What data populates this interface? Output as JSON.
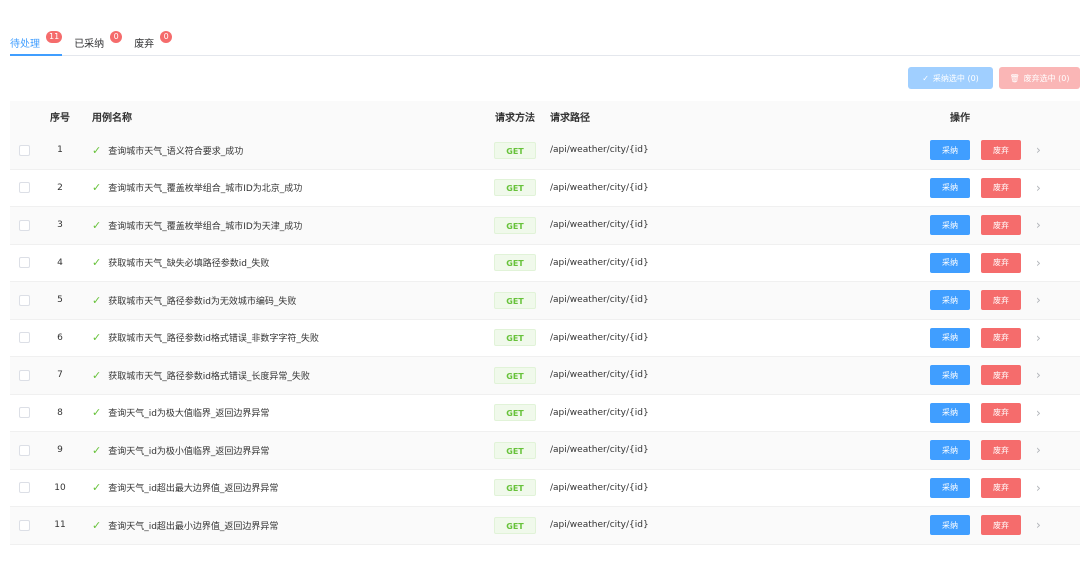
{
  "tabs": [
    {
      "label": "待处理",
      "count": "11"
    },
    {
      "label": "已采纳",
      "count": "0"
    },
    {
      "label": "废弃",
      "count": "0"
    }
  ],
  "toolbar": {
    "accept_selected": "采纳选中 (0)",
    "discard_selected": "废弃选中 (0)"
  },
  "table": {
    "headers": {
      "no": "序号",
      "name": "用例名称",
      "method": "请求方法",
      "path": "请求路径",
      "ops": "操作"
    },
    "rows": [
      {
        "no": "1",
        "name": "查询城市天气_语义符合要求_成功",
        "method": "GET",
        "path": "/api/weather/city/{id}"
      },
      {
        "no": "2",
        "name": "查询城市天气_覆盖枚举组合_城市ID为北京_成功",
        "method": "GET",
        "path": "/api/weather/city/{id}"
      },
      {
        "no": "3",
        "name": "查询城市天气_覆盖枚举组合_城市ID为天津_成功",
        "method": "GET",
        "path": "/api/weather/city/{id}"
      },
      {
        "no": "4",
        "name": "获取城市天气_缺失必填路径参数id_失败",
        "method": "GET",
        "path": "/api/weather/city/{id}"
      },
      {
        "no": "5",
        "name": "获取城市天气_路径参数id为无效城市编码_失败",
        "method": "GET",
        "path": "/api/weather/city/{id}"
      },
      {
        "no": "6",
        "name": "获取城市天气_路径参数id格式错误_非数字字符_失败",
        "method": "GET",
        "path": "/api/weather/city/{id}"
      },
      {
        "no": "7",
        "name": "获取城市天气_路径参数id格式错误_长度异常_失败",
        "method": "GET",
        "path": "/api/weather/city/{id}"
      },
      {
        "no": "8",
        "name": "查询天气_id为极大值临界_返回边界异常",
        "method": "GET",
        "path": "/api/weather/city/{id}"
      },
      {
        "no": "9",
        "name": "查询天气_id为极小值临界_返回边界异常",
        "method": "GET",
        "path": "/api/weather/city/{id}"
      },
      {
        "no": "10",
        "name": "查询天气_id超出最大边界值_返回边界异常",
        "method": "GET",
        "path": "/api/weather/city/{id}"
      },
      {
        "no": "11",
        "name": "查询天气_id超出最小边界值_返回边界异常",
        "method": "GET",
        "path": "/api/weather/city/{id}"
      }
    ],
    "accept_label": "采纳",
    "discard_label": "废弃"
  },
  "icons": {
    "check": "check-icon",
    "chevron": "chevron-right-icon"
  },
  "colors": {
    "primary": "#409eff",
    "danger": "#f56c6c",
    "success": "#67c23a"
  }
}
